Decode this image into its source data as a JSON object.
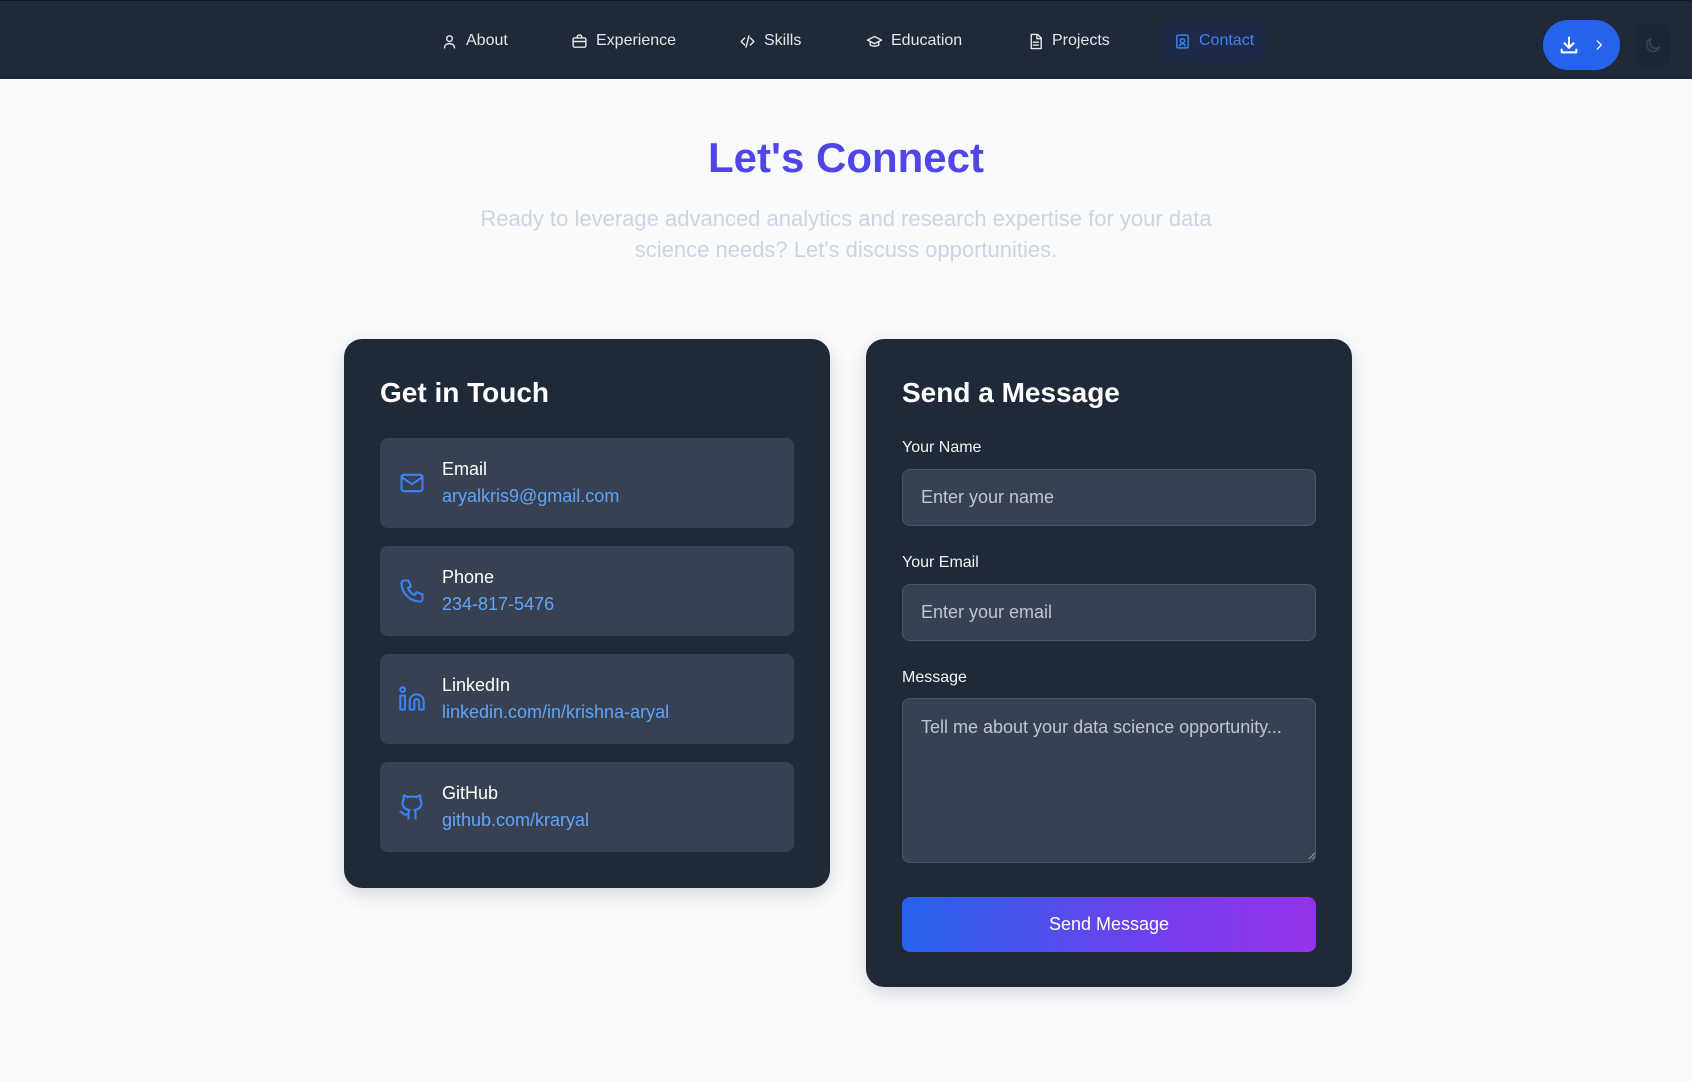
{
  "nav": {
    "items": [
      {
        "label": "About",
        "icon": "user-icon"
      },
      {
        "label": "Experience",
        "icon": "briefcase-icon"
      },
      {
        "label": "Skills",
        "icon": "code-icon"
      },
      {
        "label": "Education",
        "icon": "graduation-cap-icon"
      },
      {
        "label": "Projects",
        "icon": "document-icon"
      },
      {
        "label": "Contact",
        "icon": "contact-icon",
        "active": true
      }
    ],
    "download_icon": "download-icon",
    "theme_icon": "moon-icon"
  },
  "header": {
    "title": "Let's Connect",
    "subtitle": "Ready to leverage advanced analytics and research expertise for your data science needs? Let's discuss opportunities."
  },
  "touch": {
    "title": "Get in Touch",
    "items": [
      {
        "label": "Email",
        "value": "aryalkris9@gmail.com",
        "icon": "mail-icon"
      },
      {
        "label": "Phone",
        "value": "234-817-5476",
        "icon": "phone-icon"
      },
      {
        "label": "LinkedIn",
        "value": "linkedin.com/in/krishna-aryal",
        "icon": "linkedin-icon"
      },
      {
        "label": "GitHub",
        "value": "github.com/kraryal",
        "icon": "github-icon"
      }
    ]
  },
  "form": {
    "title": "Send a Message",
    "name_label": "Your Name",
    "name_placeholder": "Enter your name",
    "email_label": "Your Email",
    "email_placeholder": "Enter your email",
    "message_label": "Message",
    "message_placeholder": "Tell me about your data science opportunity...",
    "submit_label": "Send Message"
  },
  "colors": {
    "accent": "#3b82f6",
    "title": "#4f46e5",
    "nav_bg": "#1f2937",
    "card_bg": "#1f2937"
  }
}
